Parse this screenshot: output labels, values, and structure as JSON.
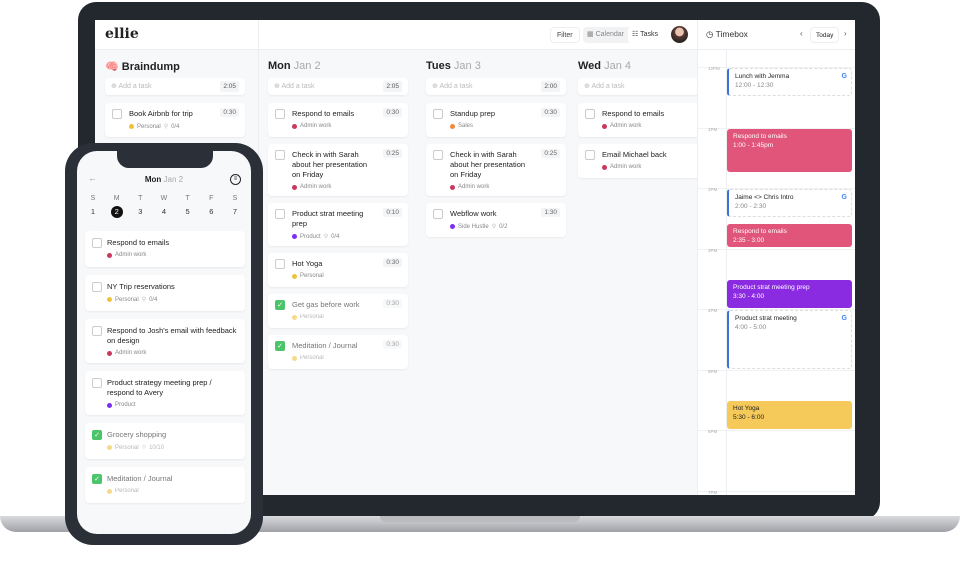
{
  "app": {
    "logo": "ellie"
  },
  "toolbar": {
    "filter": "Filter",
    "calendar": "Calendar",
    "tasks": "Tasks",
    "calendar_icon": "calendar-icon",
    "tasks_icon": "tasks-icon"
  },
  "colors": {
    "admin": "#c9385f",
    "personal": "#f0c23c",
    "product": "#7b2ff2",
    "sales": "#f08a3c",
    "side": "#7b2ff2",
    "done": "#4cc46a",
    "event_pink": "#e05579",
    "event_purple": "#8a2be2",
    "event_yellow": "#f5c95a",
    "google_blue": "#3b74d8"
  },
  "columns": [
    {
      "title": "Braindump",
      "date": "",
      "icon": "brain-icon",
      "add": "Add a task",
      "total": "2:05",
      "tasks": [
        {
          "title": "Book Airbnb for trip",
          "dur": "0:30",
          "tag": "Personal",
          "color": "personal",
          "sub": "0/4",
          "done": false
        }
      ]
    },
    {
      "title": "Mon",
      "date": "Jan 2",
      "add": "Add a task",
      "total": "2:05",
      "tasks": [
        {
          "title": "Respond to emails",
          "dur": "0:30",
          "tag": "Admin work",
          "color": "admin",
          "done": false
        },
        {
          "title": "Check in with Sarah about her presentation on Friday",
          "dur": "0:25",
          "tag": "Admin work",
          "color": "admin",
          "done": false
        },
        {
          "title": "Product strat meeting prep",
          "dur": "0:10",
          "tag": "Product",
          "color": "product",
          "sub": "0/4",
          "done": false
        },
        {
          "title": "Hot Yoga",
          "dur": "0:30",
          "tag": "Personal",
          "color": "personal",
          "done": false
        },
        {
          "title": "Get gas before work",
          "dur": "0:30",
          "tag": "Personal",
          "color": "personal",
          "done": true
        },
        {
          "title": "Meditation / Journal",
          "dur": "0:30",
          "tag": "Personal",
          "color": "personal",
          "done": true
        }
      ]
    },
    {
      "title": "Tues",
      "date": "Jan 3",
      "add": "Add a task",
      "total": "2:00",
      "tasks": [
        {
          "title": "Standup prep",
          "dur": "0:30",
          "tag": "Sales",
          "color": "sales",
          "done": false
        },
        {
          "title": "Check in with Sarah about her presentation on Friday",
          "dur": "0:25",
          "tag": "Admin work",
          "color": "admin",
          "done": false
        },
        {
          "title": "Webflow work",
          "dur": "1:30",
          "tag": "Side Hustle",
          "color": "side",
          "sub": "0/2",
          "done": false
        }
      ]
    },
    {
      "title": "Wed",
      "date": "Jan 4",
      "add": "Add a task",
      "total": "",
      "tasks": [
        {
          "title": "Respond to emails",
          "dur": "",
          "tag": "Admin work",
          "color": "admin",
          "done": false
        },
        {
          "title": "Email Michael back",
          "dur": "",
          "tag": "Admin work",
          "color": "admin",
          "done": false
        }
      ]
    }
  ],
  "timebox": {
    "title": "Timebox",
    "today": "Today",
    "hours": [
      "12PM",
      "1PM",
      "2PM",
      "3PM",
      "4PM",
      "5PM",
      "6PM",
      "7PM"
    ],
    "events": [
      {
        "title": "Lunch with Jemma",
        "time": "12:00 - 12:30",
        "start": 12.0,
        "end": 12.5,
        "kind": "google"
      },
      {
        "title": "Respond to emails",
        "time": "1:00 - 1:45pm",
        "start": 13.0,
        "end": 13.75,
        "kind": "event_pink"
      },
      {
        "title": "Jaime <> Chris Intro",
        "time": "2:00 - 2:30",
        "start": 14.0,
        "end": 14.5,
        "kind": "google"
      },
      {
        "title": "Respond to emails",
        "time": "2:35 - 3:00",
        "start": 14.58,
        "end": 15.0,
        "kind": "event_pink"
      },
      {
        "title": "Product strat meeting prep",
        "time": "3:30 - 4:00",
        "start": 15.5,
        "end": 16.0,
        "kind": "event_purple"
      },
      {
        "title": "Product strat meeting",
        "time": "4:00 - 5:00",
        "start": 16.0,
        "end": 17.0,
        "kind": "google"
      },
      {
        "title": "Hot Yoga",
        "time": "5:30 - 6:00",
        "start": 17.5,
        "end": 18.0,
        "kind": "event_yellow"
      }
    ]
  },
  "phone": {
    "title": "Mon",
    "date": "Jan 2",
    "week": [
      {
        "d": "S",
        "n": "1"
      },
      {
        "d": "M",
        "n": "2",
        "sel": true
      },
      {
        "d": "T",
        "n": "3"
      },
      {
        "d": "W",
        "n": "4"
      },
      {
        "d": "T",
        "n": "5"
      },
      {
        "d": "F",
        "n": "6"
      },
      {
        "d": "S",
        "n": "7"
      }
    ],
    "tasks": [
      {
        "title": "Respond to emails",
        "tag": "Admin work",
        "color": "admin",
        "done": false
      },
      {
        "title": "NY Trip reservations",
        "tag": "Personal",
        "color": "personal",
        "sub": "0/4",
        "done": false
      },
      {
        "title": "Respond to Josh's email with feedback on design",
        "tag": "Admin work",
        "color": "admin",
        "done": false
      },
      {
        "title": "Product strategy meeting prep / respond to Avery",
        "tag": "Product",
        "color": "product",
        "done": false
      },
      {
        "title": "Grocery shopping",
        "tag": "Personal",
        "color": "personal",
        "sub": "10/10",
        "done": true
      },
      {
        "title": "Meditation / Journal",
        "tag": "Personal",
        "color": "personal",
        "done": true
      }
    ]
  }
}
